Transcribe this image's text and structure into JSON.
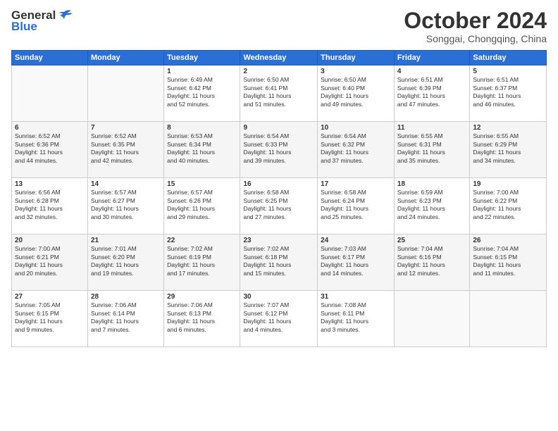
{
  "header": {
    "logo_general": "General",
    "logo_blue": "Blue",
    "title": "October 2024",
    "location": "Songgai, Chongqing, China"
  },
  "weekdays": [
    "Sunday",
    "Monday",
    "Tuesday",
    "Wednesday",
    "Thursday",
    "Friday",
    "Saturday"
  ],
  "weeks": [
    [
      {
        "day": "",
        "info": ""
      },
      {
        "day": "",
        "info": ""
      },
      {
        "day": "1",
        "info": "Sunrise: 6:49 AM\nSunset: 6:42 PM\nDaylight: 11 hours\nand 52 minutes."
      },
      {
        "day": "2",
        "info": "Sunrise: 6:50 AM\nSunset: 6:41 PM\nDaylight: 11 hours\nand 51 minutes."
      },
      {
        "day": "3",
        "info": "Sunrise: 6:50 AM\nSunset: 6:40 PM\nDaylight: 11 hours\nand 49 minutes."
      },
      {
        "day": "4",
        "info": "Sunrise: 6:51 AM\nSunset: 6:39 PM\nDaylight: 11 hours\nand 47 minutes."
      },
      {
        "day": "5",
        "info": "Sunrise: 6:51 AM\nSunset: 6:37 PM\nDaylight: 11 hours\nand 46 minutes."
      }
    ],
    [
      {
        "day": "6",
        "info": "Sunrise: 6:52 AM\nSunset: 6:36 PM\nDaylight: 11 hours\nand 44 minutes."
      },
      {
        "day": "7",
        "info": "Sunrise: 6:52 AM\nSunset: 6:35 PM\nDaylight: 11 hours\nand 42 minutes."
      },
      {
        "day": "8",
        "info": "Sunrise: 6:53 AM\nSunset: 6:34 PM\nDaylight: 11 hours\nand 40 minutes."
      },
      {
        "day": "9",
        "info": "Sunrise: 6:54 AM\nSunset: 6:33 PM\nDaylight: 11 hours\nand 39 minutes."
      },
      {
        "day": "10",
        "info": "Sunrise: 6:54 AM\nSunset: 6:32 PM\nDaylight: 11 hours\nand 37 minutes."
      },
      {
        "day": "11",
        "info": "Sunrise: 6:55 AM\nSunset: 6:31 PM\nDaylight: 11 hours\nand 35 minutes."
      },
      {
        "day": "12",
        "info": "Sunrise: 6:55 AM\nSunset: 6:29 PM\nDaylight: 11 hours\nand 34 minutes."
      }
    ],
    [
      {
        "day": "13",
        "info": "Sunrise: 6:56 AM\nSunset: 6:28 PM\nDaylight: 11 hours\nand 32 minutes."
      },
      {
        "day": "14",
        "info": "Sunrise: 6:57 AM\nSunset: 6:27 PM\nDaylight: 11 hours\nand 30 minutes."
      },
      {
        "day": "15",
        "info": "Sunrise: 6:57 AM\nSunset: 6:26 PM\nDaylight: 11 hours\nand 29 minutes."
      },
      {
        "day": "16",
        "info": "Sunrise: 6:58 AM\nSunset: 6:25 PM\nDaylight: 11 hours\nand 27 minutes."
      },
      {
        "day": "17",
        "info": "Sunrise: 6:58 AM\nSunset: 6:24 PM\nDaylight: 11 hours\nand 25 minutes."
      },
      {
        "day": "18",
        "info": "Sunrise: 6:59 AM\nSunset: 6:23 PM\nDaylight: 11 hours\nand 24 minutes."
      },
      {
        "day": "19",
        "info": "Sunrise: 7:00 AM\nSunset: 6:22 PM\nDaylight: 11 hours\nand 22 minutes."
      }
    ],
    [
      {
        "day": "20",
        "info": "Sunrise: 7:00 AM\nSunset: 6:21 PM\nDaylight: 11 hours\nand 20 minutes."
      },
      {
        "day": "21",
        "info": "Sunrise: 7:01 AM\nSunset: 6:20 PM\nDaylight: 11 hours\nand 19 minutes."
      },
      {
        "day": "22",
        "info": "Sunrise: 7:02 AM\nSunset: 6:19 PM\nDaylight: 11 hours\nand 17 minutes."
      },
      {
        "day": "23",
        "info": "Sunrise: 7:02 AM\nSunset: 6:18 PM\nDaylight: 11 hours\nand 15 minutes."
      },
      {
        "day": "24",
        "info": "Sunrise: 7:03 AM\nSunset: 6:17 PM\nDaylight: 11 hours\nand 14 minutes."
      },
      {
        "day": "25",
        "info": "Sunrise: 7:04 AM\nSunset: 6:16 PM\nDaylight: 11 hours\nand 12 minutes."
      },
      {
        "day": "26",
        "info": "Sunrise: 7:04 AM\nSunset: 6:15 PM\nDaylight: 11 hours\nand 11 minutes."
      }
    ],
    [
      {
        "day": "27",
        "info": "Sunrise: 7:05 AM\nSunset: 6:15 PM\nDaylight: 11 hours\nand 9 minutes."
      },
      {
        "day": "28",
        "info": "Sunrise: 7:06 AM\nSunset: 6:14 PM\nDaylight: 11 hours\nand 7 minutes."
      },
      {
        "day": "29",
        "info": "Sunrise: 7:06 AM\nSunset: 6:13 PM\nDaylight: 11 hours\nand 6 minutes."
      },
      {
        "day": "30",
        "info": "Sunrise: 7:07 AM\nSunset: 6:12 PM\nDaylight: 11 hours\nand 4 minutes."
      },
      {
        "day": "31",
        "info": "Sunrise: 7:08 AM\nSunset: 6:11 PM\nDaylight: 11 hours\nand 3 minutes."
      },
      {
        "day": "",
        "info": ""
      },
      {
        "day": "",
        "info": ""
      }
    ]
  ]
}
